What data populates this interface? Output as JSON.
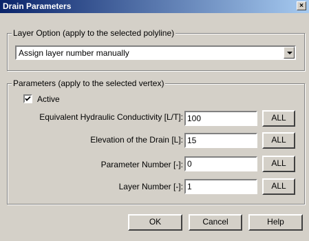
{
  "window": {
    "title": "Drain Parameters",
    "close_glyph": "×"
  },
  "layer_option": {
    "group_label": "Layer Option (apply to the selected polyline)",
    "selected": "Assign layer number manually"
  },
  "parameters": {
    "group_label": "Parameters (apply to the selected vertex)",
    "active_label": "Active",
    "active_checked": true,
    "fields": [
      {
        "label": "Equivalent Hydraulic Conductivity [L/T]:",
        "value": "100",
        "all_label": "ALL"
      },
      {
        "label": "Elevation of the Drain [L]:",
        "value": "15",
        "all_label": "ALL"
      },
      {
        "label": "Parameter Number [-]:",
        "value": "0",
        "all_label": "ALL"
      },
      {
        "label": "Layer Number [-]:",
        "value": "1",
        "all_label": "ALL"
      }
    ]
  },
  "buttons": {
    "ok": "OK",
    "cancel": "Cancel",
    "help": "Help"
  }
}
